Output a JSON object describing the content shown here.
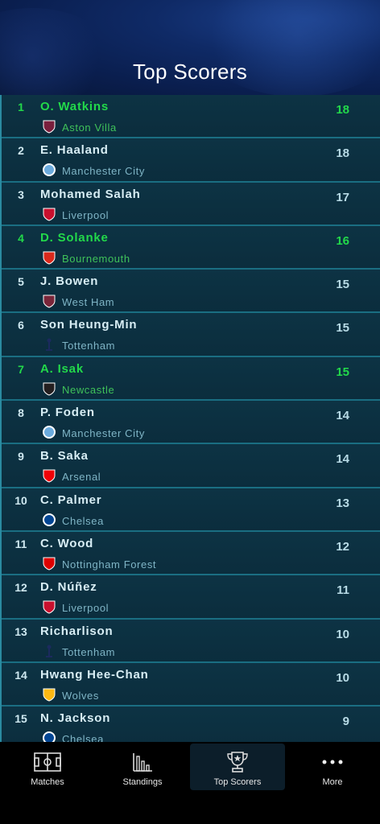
{
  "header": {
    "title": "Top Scorers"
  },
  "scorers": [
    {
      "rank": "1",
      "name": "O. Watkins",
      "club": "Aston Villa",
      "goals": "18",
      "highlight": true,
      "icon": "aston-villa-crest",
      "color": "#7a1f3d"
    },
    {
      "rank": "2",
      "name": "E. Haaland",
      "club": "Manchester City",
      "goals": "18",
      "highlight": false,
      "icon": "man-city-crest",
      "color": "#6cabdd"
    },
    {
      "rank": "3",
      "name": "Mohamed Salah",
      "club": "Liverpool",
      "goals": "17",
      "highlight": false,
      "icon": "liverpool-crest",
      "color": "#c8102e"
    },
    {
      "rank": "4",
      "name": "D. Solanke",
      "club": "Bournemouth",
      "goals": "16",
      "highlight": true,
      "icon": "bournemouth-crest",
      "color": "#da291c"
    },
    {
      "rank": "5",
      "name": "J. Bowen",
      "club": "West Ham",
      "goals": "15",
      "highlight": false,
      "icon": "west-ham-crest",
      "color": "#7a263a"
    },
    {
      "rank": "6",
      "name": "Son Heung-Min",
      "club": "Tottenham",
      "goals": "15",
      "highlight": false,
      "icon": "tottenham-crest",
      "color": "#ffffff"
    },
    {
      "rank": "7",
      "name": "A. Isak",
      "club": "Newcastle",
      "goals": "15",
      "highlight": true,
      "icon": "newcastle-crest",
      "color": "#241f20"
    },
    {
      "rank": "8",
      "name": "P. Foden",
      "club": "Manchester City",
      "goals": "14",
      "highlight": false,
      "icon": "man-city-crest",
      "color": "#6cabdd"
    },
    {
      "rank": "9",
      "name": "B. Saka",
      "club": "Arsenal",
      "goals": "14",
      "highlight": false,
      "icon": "arsenal-crest",
      "color": "#ef0107"
    },
    {
      "rank": "10",
      "name": "C. Palmer",
      "club": "Chelsea",
      "goals": "13",
      "highlight": false,
      "icon": "chelsea-crest",
      "color": "#034694"
    },
    {
      "rank": "11",
      "name": "C. Wood",
      "club": "Nottingham Forest",
      "goals": "12",
      "highlight": false,
      "icon": "nottingham-forest-crest",
      "color": "#dd0000"
    },
    {
      "rank": "12",
      "name": "D. Núñez",
      "club": "Liverpool",
      "goals": "11",
      "highlight": false,
      "icon": "liverpool-crest",
      "color": "#c8102e"
    },
    {
      "rank": "13",
      "name": "Richarlison",
      "club": "Tottenham",
      "goals": "10",
      "highlight": false,
      "icon": "tottenham-crest",
      "color": "#ffffff"
    },
    {
      "rank": "14",
      "name": "Hwang Hee-Chan",
      "club": "Wolves",
      "goals": "10",
      "highlight": false,
      "icon": "wolves-crest",
      "color": "#fdb913"
    },
    {
      "rank": "15",
      "name": "N. Jackson",
      "club": "Chelsea",
      "goals": "9",
      "highlight": false,
      "icon": "chelsea-crest",
      "color": "#034694"
    }
  ],
  "tabs": [
    {
      "label": "Matches",
      "icon": "pitch-icon",
      "active": false
    },
    {
      "label": "Standings",
      "icon": "bar-chart-icon",
      "active": false
    },
    {
      "label": "Top Scorers",
      "icon": "trophy-icon",
      "active": true
    },
    {
      "label": "More",
      "icon": "more-dots-icon",
      "active": false
    }
  ],
  "colors": {
    "highlight": "#22d94a",
    "accent": "#1a6e82",
    "background": "#0a2a3a"
  }
}
